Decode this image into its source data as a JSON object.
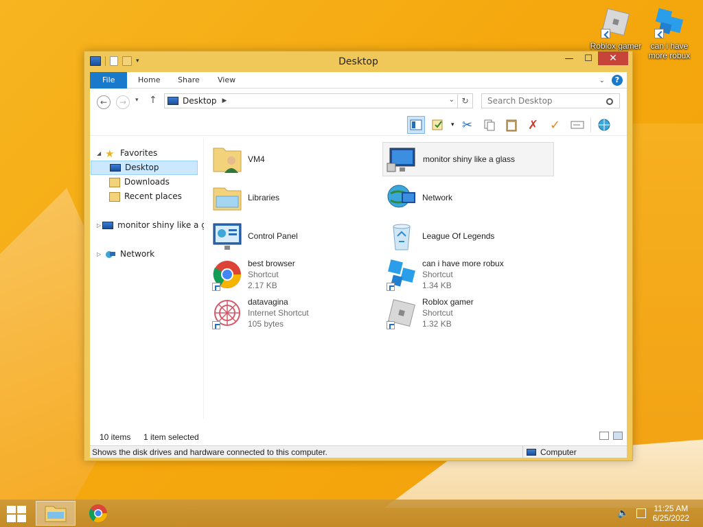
{
  "desktop": {
    "icons": [
      {
        "label": "Roblox gamer"
      },
      {
        "label": "can i have more robux"
      }
    ]
  },
  "window": {
    "title": "Desktop",
    "controls": {
      "minimize": "—",
      "maximize": "☐",
      "close": "✕"
    },
    "ribbon": {
      "tabs": [
        "File",
        "Home",
        "Share",
        "View"
      ],
      "help": "?"
    },
    "address": {
      "location": "Desktop",
      "search_placeholder": "Search Desktop"
    },
    "navigation": {
      "favorites_label": "Favorites",
      "favorites": [
        "Desktop",
        "Downloads",
        "Recent places"
      ],
      "computer": "monitor shiny like a gl",
      "network": "Network"
    },
    "items": [
      {
        "name": "VM4",
        "lines": []
      },
      {
        "name": "monitor shiny like a glass",
        "lines": []
      },
      {
        "name": "Libraries",
        "lines": []
      },
      {
        "name": "Network",
        "lines": []
      },
      {
        "name": "Control Panel",
        "lines": []
      },
      {
        "name": "League Of Legends",
        "lines": []
      },
      {
        "name": "best browser",
        "type": "Shortcut",
        "size": "2.17 KB"
      },
      {
        "name": "can i have more robux",
        "type": "Shortcut",
        "size": "1.34 KB"
      },
      {
        "name": "datavagina",
        "type": "Internet Shortcut",
        "size": "105 bytes"
      },
      {
        "name": "Roblox gamer",
        "type": "Shortcut",
        "size": "1.32 KB"
      }
    ],
    "status": {
      "item_count": "10 items",
      "selected": "1 item selected"
    },
    "info": {
      "message": "Shows the disk drives and hardware connected to this computer.",
      "location": "Computer"
    }
  },
  "taskbar": {
    "time": "11:25 AM",
    "date": "6/25/2022"
  },
  "colors": {
    "accent": "#1979ca",
    "window_frame": "#f0c85a",
    "close": "#c7443a",
    "selection": "#cce8ff"
  }
}
